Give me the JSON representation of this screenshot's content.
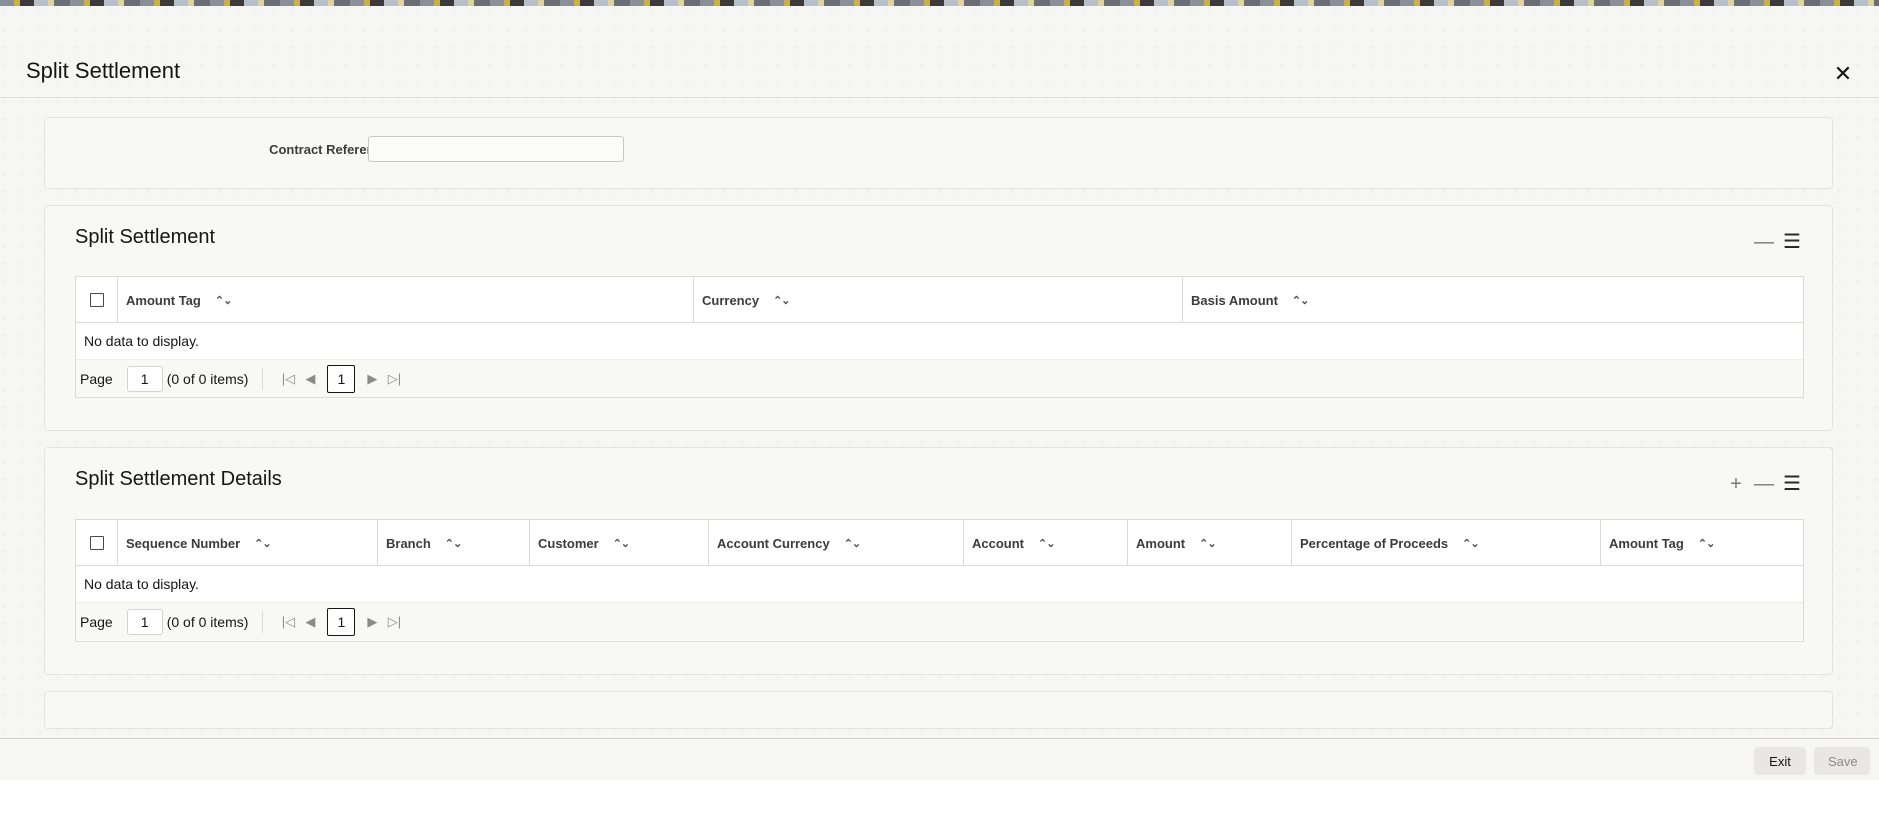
{
  "dialog": {
    "title": "Split Settlement",
    "close_icon": "close-icon"
  },
  "contract": {
    "label": "Contract Reference",
    "value": ""
  },
  "split_settlement": {
    "title": "Split Settlement",
    "columns": [
      "Amount Tag",
      "Currency",
      "Basis Amount"
    ],
    "empty_text": "No data to display.",
    "pager": {
      "page_label": "Page",
      "page_value": "1",
      "count": "(0 of 0 items)",
      "current": "1"
    }
  },
  "split_details": {
    "title": "Split Settlement Details",
    "columns": [
      "Sequence Number",
      "Branch",
      "Customer",
      "Account Currency",
      "Account",
      "Amount",
      "Percentage of Proceeds",
      "Amount Tag"
    ],
    "empty_text": "No data to display.",
    "pager": {
      "page_label": "Page",
      "page_value": "1",
      "count": "(0 of 0 items)",
      "current": "1"
    }
  },
  "footer": {
    "exit_label": "Exit",
    "save_label": "Save"
  },
  "colors": {
    "background": "#f6f6f5",
    "panel": "#f8f8f7",
    "text": "#161513",
    "disabled_text": "#8d8b88"
  }
}
